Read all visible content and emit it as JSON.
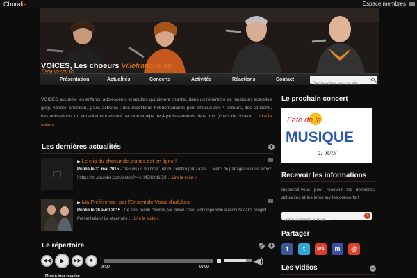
{
  "topbar": {
    "brand_main": "Choral",
    "brand_accent": "ia",
    "member_link": "Espace membres"
  },
  "site": {
    "title": "VOICES, Les choeurs",
    "subtitle": "Villefranche de",
    "subtitle_line2": "Rouergue"
  },
  "nav": {
    "items": [
      "Présentation",
      "Actualités",
      "Concerts",
      "Activités",
      "Réactions",
      "Contact"
    ]
  },
  "search": {
    "placeholder": "Rechercher sur ce site..."
  },
  "main": {
    "intro": "VOICES accueille les enfants, adolescents et adultes qui aiment chanter, dans un répertoire de musiques actuelles (pop, variété, chanson...) Les activités : des répétitions hebdomadaires pour chacun des 4 chœurs, des concerts, des animations, un encadrement assuré par une équipe de 4 professionnels de la voix (chefs de choeur, ...",
    "read_more": "Lire la suite »",
    "news_heading": "Les dernières actualités",
    "news": [
      {
        "title": "Le clip du choeur de jeunes est en ligne !",
        "count": "1",
        "date_label": "Publié le 31 mai 2015",
        "text": " - \"Je suis un homme\", rendu célèbre par Zazie … Merci de partager si vous aimez ! https://m.youtube.com/watch?v=kH4BlUzd1QU …",
        "more": "Lire la suite »"
      },
      {
        "title": "Ma Préférence, par l'Ensemble Vocal d'adultes",
        "count": "1",
        "date_label": "Publié le 26 avril 2015",
        "text": " - Ce titre, rendu célèbre par Julien Clerc, est disponible à l'écoute dans l'onglet Présentation / Le répertoire … ",
        "more": "Lire la suite »"
      }
    ],
    "repertoire_heading": "Le répertoire",
    "player": {
      "current": "00:00",
      "total": "00:00",
      "volume": 0.8
    },
    "update_note": "Mise à jour requise"
  },
  "side": {
    "concert_heading": "Le prochain concert",
    "poster": {
      "line1": "Fête de la",
      "line2": "MUSIQUE",
      "line3": "21 JUIN"
    },
    "info_heading": "Recevoir les informations",
    "info_text": "Inscrivez-vous pour recevoir les dernières actualités et les infos sur les concerts !",
    "newsletter_placeholder": "Votre adresse e-mail...",
    "share_heading": "Partager",
    "share": [
      {
        "name": "facebook-icon",
        "glyph": "f",
        "color": "#3b5998"
      },
      {
        "name": "twitter-icon",
        "glyph": "t",
        "color": "#33a6d8"
      },
      {
        "name": "google-plus-icon",
        "glyph": "g+1",
        "color": "#d9412e"
      },
      {
        "name": "myspace-icon",
        "glyph": "m",
        "color": "#3b4fa8"
      },
      {
        "name": "email-icon",
        "glyph": "@",
        "color": "#d9412e"
      }
    ],
    "videos_heading": "Les vidéos"
  }
}
